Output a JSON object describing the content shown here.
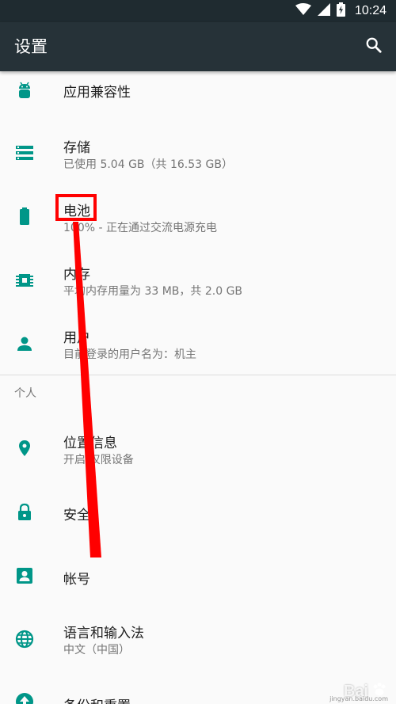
{
  "status_bar": {
    "time": "10:24"
  },
  "app_bar": {
    "title": "设置"
  },
  "items": [
    {
      "icon": "android-icon",
      "title": "应用兼容性",
      "subtitle": ""
    },
    {
      "icon": "storage-icon",
      "title": "存储",
      "subtitle": "已使用 5.04 GB（共 16.53 GB）"
    },
    {
      "icon": "battery-icon",
      "title": "电池",
      "subtitle": "100% - 正在通过交流电源充电"
    },
    {
      "icon": "memory-icon",
      "title": "内存",
      "subtitle": "平均内存用量为 33 MB，共 2.0 GB"
    },
    {
      "icon": "person-icon",
      "title": "用户",
      "subtitle": "目前登录的用户名为：机主"
    }
  ],
  "section_personal": {
    "header": "个人"
  },
  "personal_items": [
    {
      "icon": "location-icon",
      "title": "位置信息",
      "subtitle": "开启/仅限设备"
    },
    {
      "icon": "lock-icon",
      "title": "安全",
      "subtitle": ""
    },
    {
      "icon": "account-icon",
      "title": "帐号",
      "subtitle": ""
    },
    {
      "icon": "globe-icon",
      "title": "语言和输入法",
      "subtitle": "中文（中国）"
    },
    {
      "icon": "backup-icon",
      "title": "备份和重置",
      "subtitle": ""
    }
  ],
  "colors": {
    "accent": "#009688",
    "app_bar": "#263238",
    "status_bar": "#1f2b30",
    "highlight": "#ff0000"
  },
  "watermark": {
    "brand": "Bai",
    "sub": "jingyan.baidu.com"
  }
}
